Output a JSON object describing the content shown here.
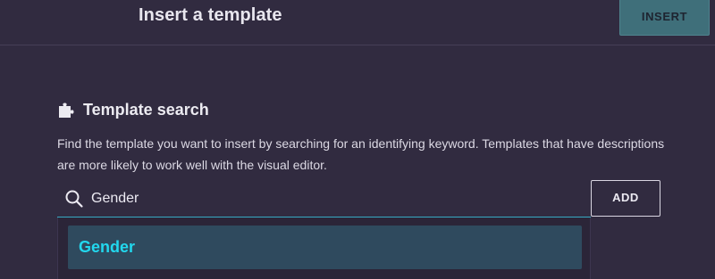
{
  "header": {
    "title": "Insert a template",
    "insert_label": "INSERT"
  },
  "template_search": {
    "icon": "puzzle-piece-icon",
    "heading": "Template search",
    "description": "Find the template you want to insert by searching for an identifying keyword. Templates that have descriptions are more likely to work well with the visual editor.",
    "search_icon": "search-icon",
    "search_value": "Gender",
    "add_label": "ADD",
    "suggestions": [
      {
        "label": "Gender",
        "highlighted": true
      }
    ]
  },
  "colors": {
    "background": "#312b40",
    "accent": "#36a9c2",
    "insert_button": "#3f6f7a",
    "suggestion_highlight": "#2f4a5e",
    "suggestion_text": "#22d8ee"
  }
}
